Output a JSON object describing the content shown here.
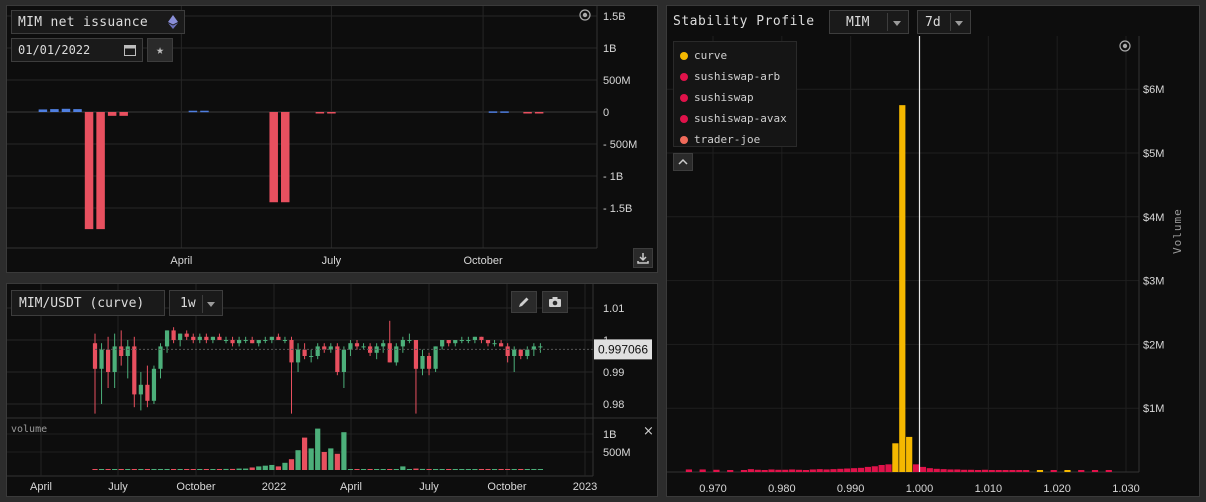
{
  "issuance": {
    "title": "MIM net issuance",
    "date_value": "01/01/2022",
    "icons": {
      "network": "ethereum-icon",
      "calendar": "calendar-icon",
      "favorite": "star-icon",
      "download": "download-icon",
      "settings": "target-icon"
    },
    "colors": {
      "positive": "#4f7fe0",
      "negative": "#e8505f"
    },
    "chart_data": {
      "type": "bar",
      "y_axis_ticks": [
        "1.5B",
        "1B",
        "500M",
        "0",
        "- 500M",
        "- 1B",
        "- 1.5B"
      ],
      "x_axis_ticks": [
        "April",
        "July",
        "October"
      ],
      "ylim": [
        -1800000000,
        1600000000
      ],
      "bars": [
        {
          "date": "2022-01-07",
          "value": 40000000
        },
        {
          "date": "2022-01-14",
          "value": 45000000
        },
        {
          "date": "2022-01-21",
          "value": 50000000
        },
        {
          "date": "2022-01-28",
          "value": 45000000
        },
        {
          "date": "2022-02-04",
          "value": -1830000000
        },
        {
          "date": "2022-02-11",
          "value": -1830000000
        },
        {
          "date": "2022-02-18",
          "value": -60000000
        },
        {
          "date": "2022-02-25",
          "value": -60000000
        },
        {
          "date": "2022-04-08",
          "value": 20000000
        },
        {
          "date": "2022-04-15",
          "value": 20000000
        },
        {
          "date": "2022-05-27",
          "value": -1410000000
        },
        {
          "date": "2022-06-03",
          "value": -1410000000
        },
        {
          "date": "2022-06-24",
          "value": -20000000
        },
        {
          "date": "2022-07-01",
          "value": -20000000
        },
        {
          "date": "2022-10-07",
          "value": 10000000
        },
        {
          "date": "2022-10-14",
          "value": 10000000
        },
        {
          "date": "2022-10-28",
          "value": -20000000
        },
        {
          "date": "2022-11-04",
          "value": -20000000
        }
      ]
    }
  },
  "mim_chart": {
    "pair_label": "MIM/USDT (curve)",
    "interval": "1w",
    "last_price": "0.997066",
    "volume_label": "volume",
    "close_symbol": "×",
    "icons": {
      "edit": "pencil-icon",
      "screenshot": "camera-icon",
      "close": "close-icon"
    },
    "colors": {
      "up": "#4caf7a",
      "down": "#e8505f",
      "tag_bg": "#e0e0e0"
    },
    "chart_data": {
      "type": "candlestick",
      "price_ticks": [
        "1.01",
        "1",
        "0.99",
        "0.98"
      ],
      "volume_ticks": [
        "1B",
        "500M"
      ],
      "x_axis_ticks": [
        "April",
        "July",
        "October",
        "2022",
        "April",
        "July",
        "October",
        "2023"
      ],
      "price_ylim": [
        0.975,
        1.012
      ],
      "series_start": "2021-06",
      "candles": [
        {
          "o": 0.999,
          "h": 1.002,
          "l": 0.977,
          "c": 0.991
        },
        {
          "o": 0.991,
          "h": 0.999,
          "l": 0.98,
          "c": 0.997
        },
        {
          "o": 0.997,
          "h": 1.001,
          "l": 0.985,
          "c": 0.99
        },
        {
          "o": 0.99,
          "h": 1.002,
          "l": 0.985,
          "c": 0.998
        },
        {
          "o": 0.998,
          "h": 1.003,
          "l": 0.992,
          "c": 0.995
        },
        {
          "o": 0.995,
          "h": 1.0,
          "l": 0.988,
          "c": 0.998
        },
        {
          "o": 0.998,
          "h": 1.001,
          "l": 0.979,
          "c": 0.983
        },
        {
          "o": 0.983,
          "h": 0.99,
          "l": 0.978,
          "c": 0.986
        },
        {
          "o": 0.986,
          "h": 0.992,
          "l": 0.979,
          "c": 0.981
        },
        {
          "o": 0.981,
          "h": 0.992,
          "l": 0.98,
          "c": 0.991
        },
        {
          "o": 0.991,
          "h": 0.999,
          "l": 0.988,
          "c": 0.998
        },
        {
          "o": 0.998,
          "h": 1.003,
          "l": 0.996,
          "c": 1.003
        },
        {
          "o": 1.003,
          "h": 1.004,
          "l": 0.999,
          "c": 1.0
        },
        {
          "o": 1.0,
          "h": 1.002,
          "l": 0.998,
          "c": 1.002
        },
        {
          "o": 1.002,
          "h": 1.003,
          "l": 1.0,
          "c": 1.001
        },
        {
          "o": 1.001,
          "h": 1.002,
          "l": 0.999,
          "c": 1.0
        },
        {
          "o": 1.0,
          "h": 1.002,
          "l": 0.999,
          "c": 1.001
        },
        {
          "o": 1.001,
          "h": 1.002,
          "l": 0.999,
          "c": 1.0
        },
        {
          "o": 1.0,
          "h": 1.001,
          "l": 0.999,
          "c": 1.001
        },
        {
          "o": 1.001,
          "h": 1.002,
          "l": 1.0,
          "c": 1.0
        },
        {
          "o": 1.0,
          "h": 1.001,
          "l": 0.999,
          "c": 1.0
        },
        {
          "o": 1.0,
          "h": 1.001,
          "l": 0.998,
          "c": 0.999
        },
        {
          "o": 0.999,
          "h": 1.001,
          "l": 0.998,
          "c": 1.0
        },
        {
          "o": 1.0,
          "h": 1.001,
          "l": 0.999,
          "c": 1.0
        },
        {
          "o": 1.0,
          "h": 1.001,
          "l": 0.999,
          "c": 0.999
        },
        {
          "o": 0.999,
          "h": 1.0,
          "l": 0.998,
          "c": 1.0
        },
        {
          "o": 1.0,
          "h": 1.001,
          "l": 0.999,
          "c": 1.0
        },
        {
          "o": 1.0,
          "h": 1.001,
          "l": 0.999,
          "c": 1.001
        },
        {
          "o": 1.001,
          "h": 1.002,
          "l": 1.0,
          "c": 1.0
        },
        {
          "o": 1.0,
          "h": 1.001,
          "l": 0.999,
          "c": 1.0
        },
        {
          "o": 1.0,
          "h": 1.001,
          "l": 0.977,
          "c": 0.993
        },
        {
          "o": 0.993,
          "h": 0.999,
          "l": 0.99,
          "c": 0.997
        },
        {
          "o": 0.997,
          "h": 0.999,
          "l": 0.994,
          "c": 0.995
        },
        {
          "o": 0.995,
          "h": 0.997,
          "l": 0.993,
          "c": 0.995
        },
        {
          "o": 0.995,
          "h": 0.999,
          "l": 0.994,
          "c": 0.998
        },
        {
          "o": 0.998,
          "h": 0.999,
          "l": 0.996,
          "c": 0.997
        },
        {
          "o": 0.997,
          "h": 0.999,
          "l": 0.996,
          "c": 0.998
        },
        {
          "o": 0.998,
          "h": 0.999,
          "l": 0.989,
          "c": 0.99
        },
        {
          "o": 0.99,
          "h": 0.998,
          "l": 0.985,
          "c": 0.997
        },
        {
          "o": 0.997,
          "h": 1.0,
          "l": 0.995,
          "c": 0.999
        },
        {
          "o": 0.999,
          "h": 1.0,
          "l": 0.997,
          "c": 0.998
        },
        {
          "o": 0.998,
          "h": 0.999,
          "l": 0.997,
          "c": 0.998
        },
        {
          "o": 0.998,
          "h": 0.999,
          "l": 0.995,
          "c": 0.996
        },
        {
          "o": 0.996,
          "h": 0.999,
          "l": 0.994,
          "c": 0.998
        },
        {
          "o": 0.998,
          "h": 1.0,
          "l": 0.996,
          "c": 0.999
        },
        {
          "o": 0.999,
          "h": 1.006,
          "l": 0.993,
          "c": 0.993
        },
        {
          "o": 0.993,
          "h": 0.999,
          "l": 0.992,
          "c": 0.998
        },
        {
          "o": 0.998,
          "h": 1.001,
          "l": 0.996,
          "c": 1.0
        },
        {
          "o": 1.0,
          "h": 1.002,
          "l": 0.999,
          "c": 1.0
        },
        {
          "o": 1.0,
          "h": 1.0,
          "l": 0.977,
          "c": 0.991
        },
        {
          "o": 0.991,
          "h": 0.997,
          "l": 0.989,
          "c": 0.995
        },
        {
          "o": 0.995,
          "h": 0.996,
          "l": 0.989,
          "c": 0.991
        },
        {
          "o": 0.991,
          "h": 0.998,
          "l": 0.99,
          "c": 0.998
        },
        {
          "o": 0.998,
          "h": 1.0,
          "l": 0.997,
          "c": 1.0
        },
        {
          "o": 1.0,
          "h": 1.0,
          "l": 0.998,
          "c": 0.999
        },
        {
          "o": 0.999,
          "h": 1.0,
          "l": 0.998,
          "c": 1.0
        },
        {
          "o": 1.0,
          "h": 1.001,
          "l": 0.999,
          "c": 1.0
        },
        {
          "o": 1.0,
          "h": 1.001,
          "l": 0.999,
          "c": 1.0
        },
        {
          "o": 1.0,
          "h": 1.001,
          "l": 0.999,
          "c": 1.001
        },
        {
          "o": 1.001,
          "h": 1.001,
          "l": 0.999,
          "c": 1.0
        },
        {
          "o": 1.0,
          "h": 1.0,
          "l": 0.998,
          "c": 0.999
        },
        {
          "o": 0.999,
          "h": 1.0,
          "l": 0.998,
          "c": 0.999
        },
        {
          "o": 0.999,
          "h": 1.0,
          "l": 0.998,
          "c": 0.998
        },
        {
          "o": 0.998,
          "h": 0.999,
          "l": 0.993,
          "c": 0.995
        },
        {
          "o": 0.995,
          "h": 0.998,
          "l": 0.99,
          "c": 0.997
        },
        {
          "o": 0.997,
          "h": 0.997,
          "l": 0.994,
          "c": 0.995
        },
        {
          "o": 0.995,
          "h": 0.998,
          "l": 0.994,
          "c": 0.997
        },
        {
          "o": 0.997,
          "h": 0.999,
          "l": 0.995,
          "c": 0.998
        },
        {
          "o": 0.998,
          "h": 0.999,
          "l": 0.996,
          "c": 0.998
        }
      ],
      "volumes": [
        0.02,
        0.02,
        0.02,
        0.02,
        0.02,
        0.02,
        0.02,
        0.02,
        0.02,
        0.02,
        0.02,
        0.02,
        0.02,
        0.02,
        0.02,
        0.02,
        0.02,
        0.02,
        0.02,
        0.02,
        0.03,
        0.03,
        0.04,
        0.04,
        0.07,
        0.1,
        0.12,
        0.14,
        0.1,
        0.2,
        0.3,
        0.55,
        0.9,
        0.6,
        1.15,
        0.5,
        0.6,
        0.45,
        1.05,
        0.02,
        0.02,
        0.02,
        0.02,
        0.02,
        0.02,
        0.02,
        0.02,
        0.1,
        0.02,
        0.04,
        0.03,
        0.02,
        0.02,
        0.02,
        0.02,
        0.02,
        0.02,
        0.02,
        0.02,
        0.02,
        0.02,
        0.02,
        0.02,
        0.02,
        0.02,
        0.02,
        0.02,
        0.02,
        0.02,
        0.02
      ]
    }
  },
  "stability": {
    "title": "Stability Profile",
    "token": "MIM",
    "period": "7d",
    "y_label": "Volume",
    "icons": {
      "collapse": "chevron-up-icon",
      "settings": "target-icon"
    },
    "legend": [
      {
        "label": "curve",
        "color": "#f5b800"
      },
      {
        "label": "sushiswap-arb",
        "color": "#e0124a"
      },
      {
        "label": "sushiswap",
        "color": "#e0124a"
      },
      {
        "label": "sushiswap-avax",
        "color": "#e0124a"
      },
      {
        "label": "trader-joe",
        "color": "#f06a5a"
      }
    ],
    "chart_data": {
      "type": "bar",
      "x_ticks": [
        "0.970",
        "0.980",
        "0.990",
        "1.000",
        "1.010",
        "1.020",
        "1.030"
      ],
      "y_ticks": [
        "$6M",
        "$5M",
        "$4M",
        "$3M",
        "$2M",
        "$1M"
      ],
      "xlim": [
        0.9655,
        1.0315
      ],
      "ylim": [
        0,
        6800000
      ],
      "peg_line": 1.0,
      "bars": [
        {
          "x": 0.9665,
          "value": 40000,
          "series": "sushiswap"
        },
        {
          "x": 0.9685,
          "value": 40000,
          "series": "sushiswap"
        },
        {
          "x": 0.9705,
          "value": 35000,
          "series": "sushiswap"
        },
        {
          "x": 0.9725,
          "value": 30000,
          "series": "sushiswap"
        },
        {
          "x": 0.9745,
          "value": 30000,
          "series": "sushiswap"
        },
        {
          "x": 0.9755,
          "value": 45000,
          "series": "sushiswap"
        },
        {
          "x": 0.9765,
          "value": 35000,
          "series": "sushiswap"
        },
        {
          "x": 0.9775,
          "value": 30000,
          "series": "sushiswap"
        },
        {
          "x": 0.9785,
          "value": 40000,
          "series": "sushiswap"
        },
        {
          "x": 0.9795,
          "value": 35000,
          "series": "sushiswap"
        },
        {
          "x": 0.9805,
          "value": 35000,
          "series": "sushiswap"
        },
        {
          "x": 0.9815,
          "value": 40000,
          "series": "sushiswap"
        },
        {
          "x": 0.9825,
          "value": 35000,
          "series": "sushiswap"
        },
        {
          "x": 0.9835,
          "value": 30000,
          "series": "sushiswap"
        },
        {
          "x": 0.9845,
          "value": 40000,
          "series": "sushiswap"
        },
        {
          "x": 0.9855,
          "value": 45000,
          "series": "sushiswap"
        },
        {
          "x": 0.9865,
          "value": 40000,
          "series": "sushiswap"
        },
        {
          "x": 0.9875,
          "value": 45000,
          "series": "sushiswap"
        },
        {
          "x": 0.9885,
          "value": 50000,
          "series": "sushiswap"
        },
        {
          "x": 0.9895,
          "value": 55000,
          "series": "sushiswap"
        },
        {
          "x": 0.9905,
          "value": 60000,
          "series": "sushiswap"
        },
        {
          "x": 0.9915,
          "value": 65000,
          "series": "sushiswap"
        },
        {
          "x": 0.9925,
          "value": 80000,
          "series": "sushiswap"
        },
        {
          "x": 0.9935,
          "value": 90000,
          "series": "sushiswap"
        },
        {
          "x": 0.9945,
          "value": 110000,
          "series": "sushiswap"
        },
        {
          "x": 0.9955,
          "value": 120000,
          "series": "sushiswap"
        },
        {
          "x": 0.9965,
          "value": 130000,
          "series": "sushiswap"
        },
        {
          "x": 0.9965,
          "value": 450000,
          "series": "curve"
        },
        {
          "x": 0.9975,
          "value": 5750000,
          "series": "curve"
        },
        {
          "x": 0.9985,
          "value": 550000,
          "series": "curve"
        },
        {
          "x": 0.9995,
          "value": 120000,
          "series": "sushiswap"
        },
        {
          "x": 1.0005,
          "value": 80000,
          "series": "sushiswap"
        },
        {
          "x": 1.0015,
          "value": 60000,
          "series": "sushiswap"
        },
        {
          "x": 1.0025,
          "value": 50000,
          "series": "sushiswap"
        },
        {
          "x": 1.0035,
          "value": 45000,
          "series": "sushiswap"
        },
        {
          "x": 1.0045,
          "value": 40000,
          "series": "sushiswap"
        },
        {
          "x": 1.0055,
          "value": 40000,
          "series": "sushiswap"
        },
        {
          "x": 1.0065,
          "value": 35000,
          "series": "sushiswap"
        },
        {
          "x": 1.0075,
          "value": 35000,
          "series": "sushiswap"
        },
        {
          "x": 1.0085,
          "value": 30000,
          "series": "sushiswap"
        },
        {
          "x": 1.0095,
          "value": 35000,
          "series": "sushiswap"
        },
        {
          "x": 1.0105,
          "value": 30000,
          "series": "sushiswap"
        },
        {
          "x": 1.0115,
          "value": 30000,
          "series": "sushiswap"
        },
        {
          "x": 1.0125,
          "value": 25000,
          "series": "sushiswap"
        },
        {
          "x": 1.0135,
          "value": 30000,
          "series": "sushiswap"
        },
        {
          "x": 1.0145,
          "value": 25000,
          "series": "sushiswap"
        },
        {
          "x": 1.0155,
          "value": 25000,
          "series": "sushiswap"
        },
        {
          "x": 1.0175,
          "value": 30000,
          "series": "curve"
        },
        {
          "x": 1.0195,
          "value": 25000,
          "series": "sushiswap"
        },
        {
          "x": 1.0215,
          "value": 30000,
          "series": "curve"
        },
        {
          "x": 1.0235,
          "value": 25000,
          "series": "sushiswap"
        },
        {
          "x": 1.0255,
          "value": 25000,
          "series": "sushiswap"
        },
        {
          "x": 1.0275,
          "value": 25000,
          "series": "sushiswap"
        }
      ]
    }
  }
}
